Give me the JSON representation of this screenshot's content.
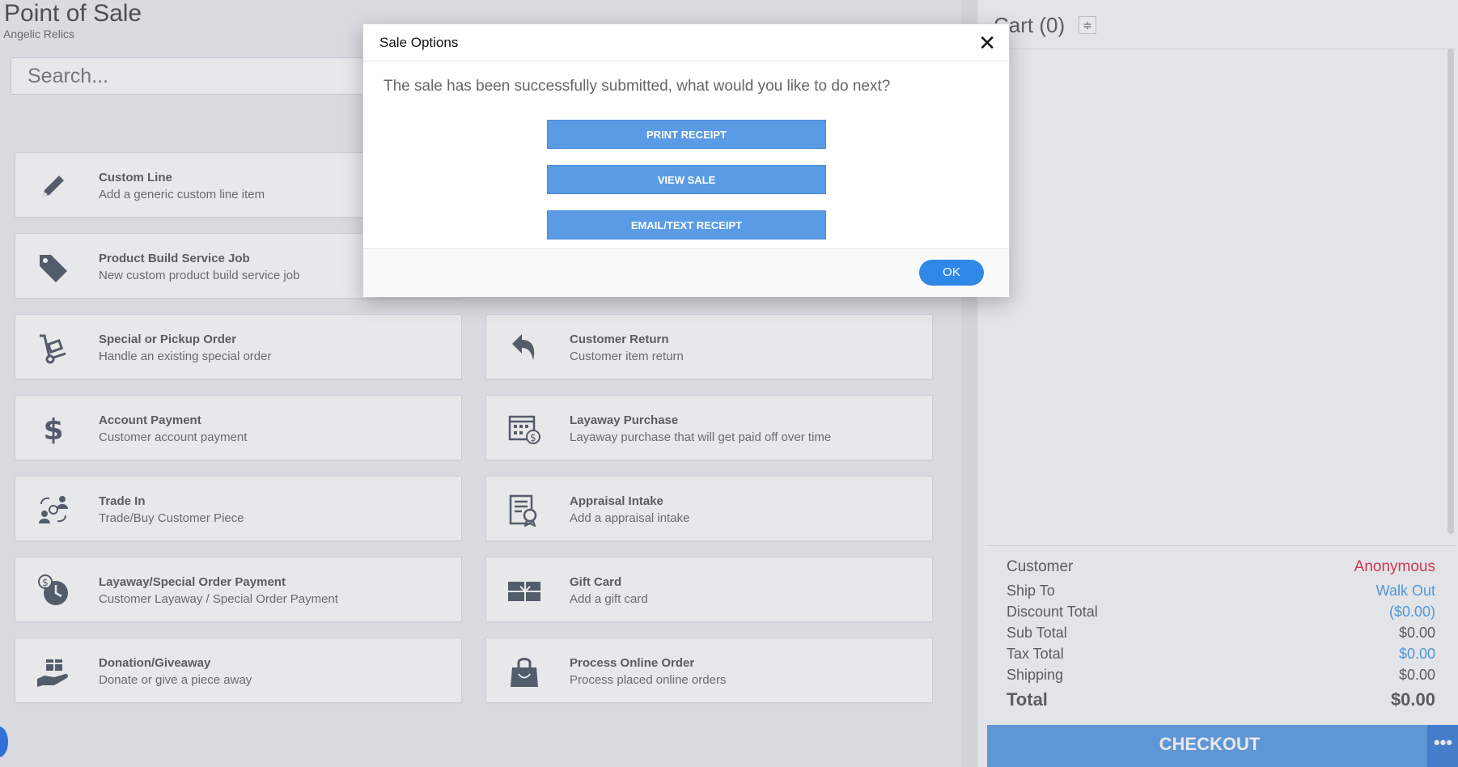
{
  "header": {
    "title": "Point of Sale",
    "subtitle": "Angelic Relics"
  },
  "search": {
    "placeholder": "Search..."
  },
  "tiles": [
    {
      "title": "Custom Line",
      "desc": "Add a generic custom line item",
      "icon": "pencil-icon"
    },
    {
      "title": "Product Build Service Job",
      "desc": "New custom product build service job",
      "icon": "tag-icon"
    },
    {
      "title": "Special or Pickup Order",
      "desc": "Handle an existing special order",
      "icon": "hand-truck-icon"
    },
    {
      "title": "Customer Return",
      "desc": "Customer item return",
      "icon": "return-arrow-icon"
    },
    {
      "title": "Account Payment",
      "desc": "Customer account payment",
      "icon": "dollar-icon"
    },
    {
      "title": "Layaway Purchase",
      "desc": "Layaway purchase that will get paid off over time",
      "icon": "calendar-dollar-icon"
    },
    {
      "title": "Trade In",
      "desc": "Trade/Buy Customer Piece",
      "icon": "trade-in-icon"
    },
    {
      "title": "Appraisal Intake",
      "desc": "Add a appraisal intake",
      "icon": "certificate-icon"
    },
    {
      "title": "Layaway/Special Order Payment",
      "desc": "Customer Layaway / Special Order Payment",
      "icon": "clock-dollar-icon"
    },
    {
      "title": "Gift Card",
      "desc": "Add a gift card",
      "icon": "gift-card-icon"
    },
    {
      "title": "Donation/Giveaway",
      "desc": "Donate or give a piece away",
      "icon": "gift-hand-icon"
    },
    {
      "title": "Process Online Order",
      "desc": "Process placed online orders",
      "icon": "shopping-bag-icon"
    }
  ],
  "cart": {
    "title": "Cart (0)",
    "summary": {
      "customer_label": "Customer",
      "customer_value": "Anonymous",
      "ship_label": "Ship To",
      "ship_value": "Walk Out",
      "discount_label": "Discount Total",
      "discount_value": "($0.00)",
      "subtotal_label": "Sub Total",
      "subtotal_value": "$0.00",
      "tax_label": "Tax Total",
      "tax_value": "$0.00",
      "shipping_label": "Shipping",
      "shipping_value": "$0.00",
      "total_label": "Total",
      "total_value": "$0.00"
    },
    "checkout_label": "CHECKOUT",
    "more_label": "•••"
  },
  "modal": {
    "title": "Sale Options",
    "close": "✕",
    "message": "The sale has been successfully submitted, what would you like to do next?",
    "buttons": [
      "PRINT RECEIPT",
      "VIEW SALE",
      "EMAIL/TEXT RECEIPT"
    ],
    "ok_label": "OK"
  },
  "colors": {
    "accent": "#5a9be6",
    "ok": "#2f88e8",
    "anonymous": "#e0284a",
    "link": "#4a9be8",
    "icon": "#4b5563"
  }
}
